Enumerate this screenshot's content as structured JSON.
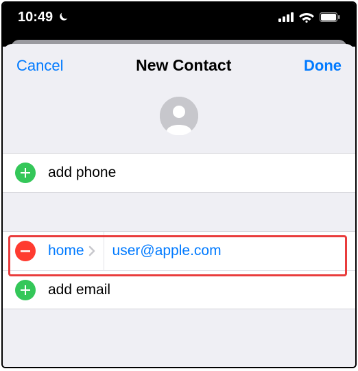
{
  "status": {
    "time": "10:49"
  },
  "nav": {
    "cancel": "Cancel",
    "title": "New Contact",
    "done": "Done"
  },
  "phone": {
    "add_label": "add phone"
  },
  "email": {
    "type_label": "home",
    "value": "user@apple.com",
    "add_label": "add email"
  }
}
